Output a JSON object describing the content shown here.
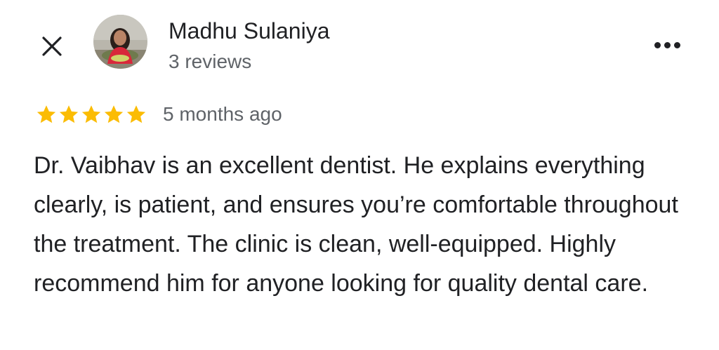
{
  "review": {
    "reviewer_name": "Madhu Sulaniya",
    "review_count": "3 reviews",
    "rating": 5,
    "rating_max": 5,
    "time_ago": "5 months ago",
    "text": "Dr. Vaibhav is an excellent dentist. He explains everything clearly, is patient, and ensures you’re comfortable throughout the treatment. The clinic is clean, well-equipped. Highly recommend him for anyone looking for quality dental care."
  },
  "icons": {
    "close": "close-icon",
    "more": "more-horizontal-icon",
    "star": "star-icon"
  },
  "colors": {
    "star": "#fbbc04",
    "primary_text": "#202124",
    "secondary_text": "#5f6368"
  }
}
